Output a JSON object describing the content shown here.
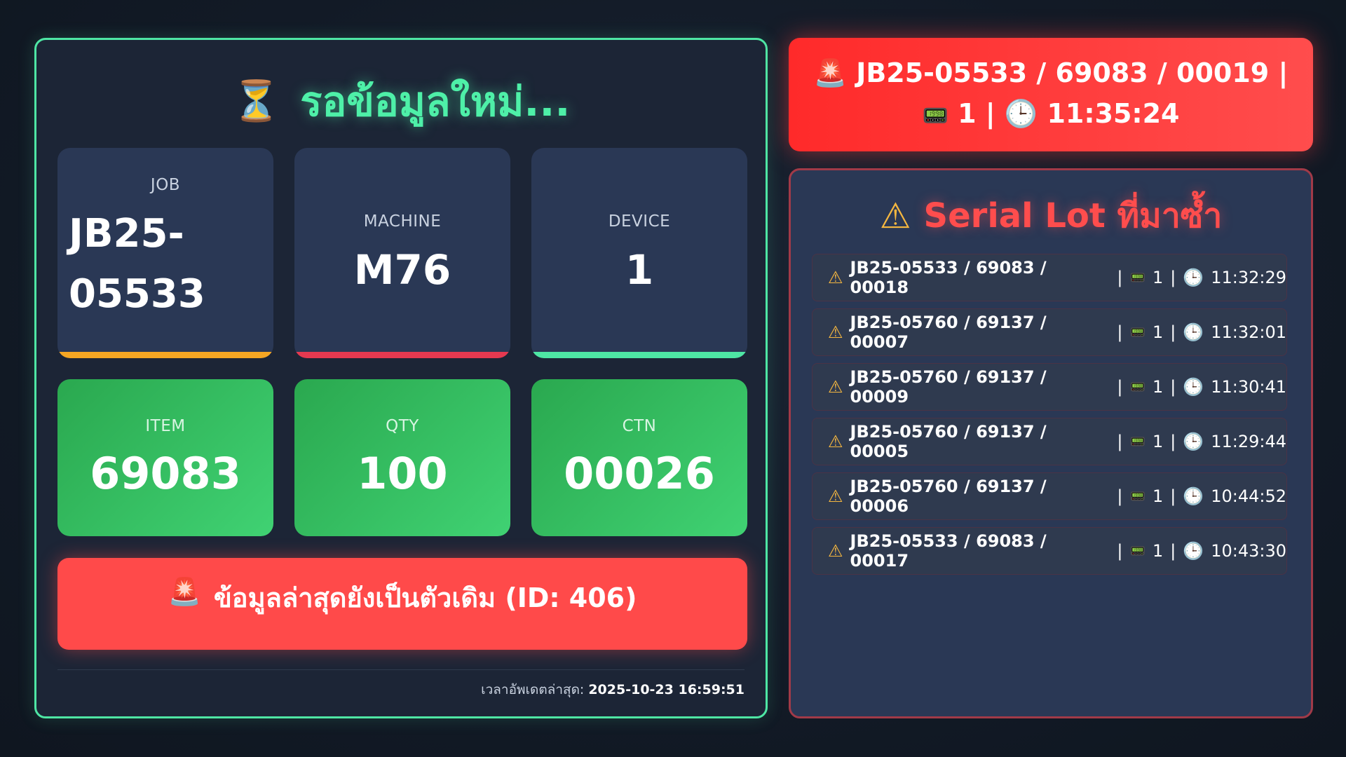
{
  "status": {
    "title": "รอข้อมูลใหม่...",
    "icon": "hourglass-icon"
  },
  "cards": {
    "job": {
      "label": "JOB",
      "value": "JB25-05533",
      "accent": "#f5a623"
    },
    "machine": {
      "label": "MACHINE",
      "value": "M76",
      "accent": "#e53950"
    },
    "device": {
      "label": "DEVICE",
      "value": "1",
      "accent": "#4ee6a4"
    },
    "item": {
      "label": "ITEM",
      "value": "69083"
    },
    "qty": {
      "label": "QTY",
      "value": "100"
    },
    "ctn": {
      "label": "CTN",
      "value": "00026"
    }
  },
  "alert": {
    "icon": "siren-icon",
    "text": "ข้อมูลล่าสุดยังเป็นตัวเดิม (ID: 406)"
  },
  "last_updated": {
    "label": "เวลาอัพเดตล่าสุด:",
    "value": "2025-10-23 16:59:51"
  },
  "top_alert": {
    "code": "JB25-05533 / 69083 / 00019 |",
    "device": "1 |",
    "time": "11:35:24"
  },
  "duplicates": {
    "title": "Serial Lot ที่มาซ้ำ",
    "items": [
      {
        "code": "JB25-05533 / 69083 / 00018",
        "device": "1",
        "time": "11:32:29"
      },
      {
        "code": "JB25-05760 / 69137 / 00007",
        "device": "1",
        "time": "11:32:01"
      },
      {
        "code": "JB25-05760 / 69137 / 00009",
        "device": "1",
        "time": "11:30:41"
      },
      {
        "code": "JB25-05760 / 69137 / 00005",
        "device": "1",
        "time": "11:29:44"
      },
      {
        "code": "JB25-05760 / 69137 / 00006",
        "device": "1",
        "time": "10:44:52"
      },
      {
        "code": "JB25-05533 / 69083 / 00017",
        "device": "1",
        "time": "10:43:30"
      }
    ]
  },
  "colors": {
    "accent_green": "#4ef0a8",
    "alert_red": "#ff4a4a",
    "warning": "#f5b740"
  }
}
